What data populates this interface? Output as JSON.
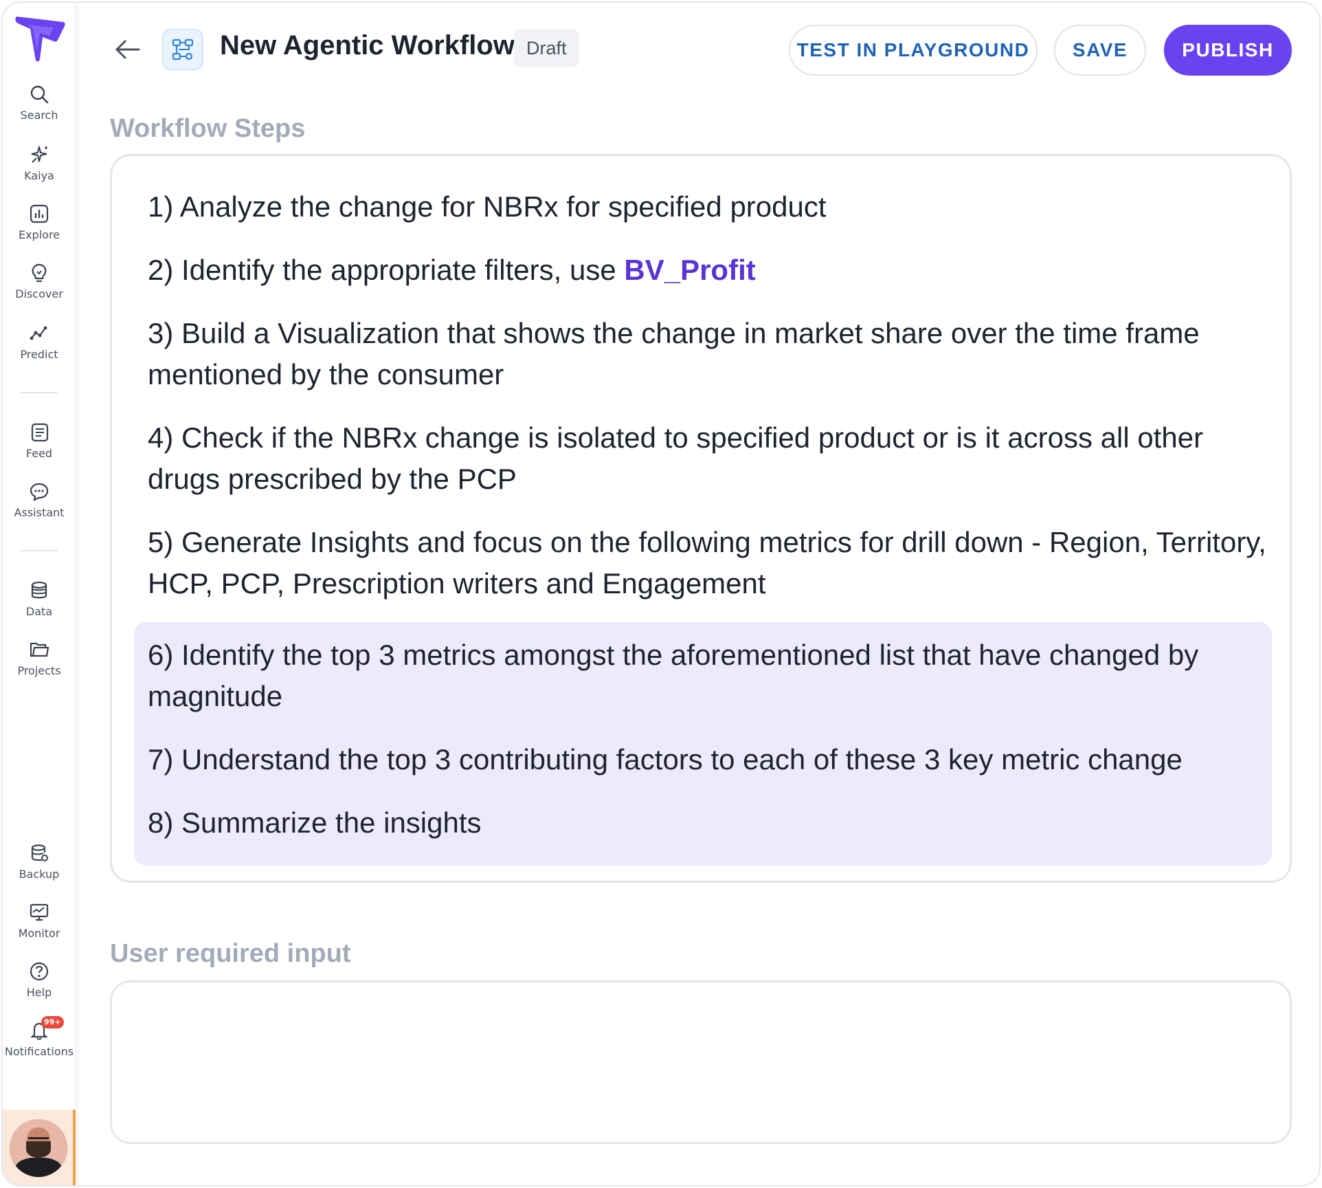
{
  "header": {
    "title": "New Agentic Workflow",
    "status": "Draft",
    "buttons": {
      "test": "TEST IN PLAYGROUND",
      "save": "SAVE",
      "publish": "PUBLISH"
    }
  },
  "sidebar": {
    "items": [
      {
        "label": "Search",
        "icon": "search-icon"
      },
      {
        "label": "Kaiya",
        "icon": "sparkle-icon"
      },
      {
        "label": "Explore",
        "icon": "chart-icon"
      },
      {
        "label": "Discover",
        "icon": "bulb-icon"
      },
      {
        "label": "Predict",
        "icon": "trend-icon"
      },
      {
        "label": "Feed",
        "icon": "feed-icon"
      },
      {
        "label": "Assistant",
        "icon": "chat-icon"
      },
      {
        "label": "Data",
        "icon": "database-icon"
      },
      {
        "label": "Projects",
        "icon": "folder-icon"
      },
      {
        "label": "Backup",
        "icon": "backup-icon"
      },
      {
        "label": "Monitor",
        "icon": "monitor-icon"
      },
      {
        "label": "Help",
        "icon": "help-icon"
      },
      {
        "label": "Notifications",
        "icon": "bell-icon",
        "badge": "99+"
      }
    ]
  },
  "workflow": {
    "label": "Workflow Steps",
    "steps": [
      {
        "text": "1) Analyze the change for NBRx for specified product"
      },
      {
        "text": "2) Identify the appropriate filters, use ",
        "ref": "BV_Profit"
      },
      {
        "text": "3) Build a Visualization that shows the change in market share over the time frame mentioned by the consumer"
      },
      {
        "text": "4) Check if the NBRx change is isolated to specified product or is it across all other drugs prescribed by the PCP"
      },
      {
        "text": "5) Generate Insights and focus on the following metrics for drill down - Region, Territory, HCP, PCP, Prescription writers and Engagement"
      },
      {
        "text": "6) Identify the top 3 metrics amongst the aforementioned list that have changed by magnitude"
      },
      {
        "text": "7) Understand the top 3 contributing factors to each of these 3 key metric change"
      },
      {
        "text": "8) Summarize the insights"
      }
    ]
  },
  "user_input": {
    "label": "User required input",
    "value": ""
  },
  "colors": {
    "accent": "#6a43f0",
    "link": "#1f63b5",
    "highlight": "#eeeafd",
    "badge": "#e8483b"
  }
}
